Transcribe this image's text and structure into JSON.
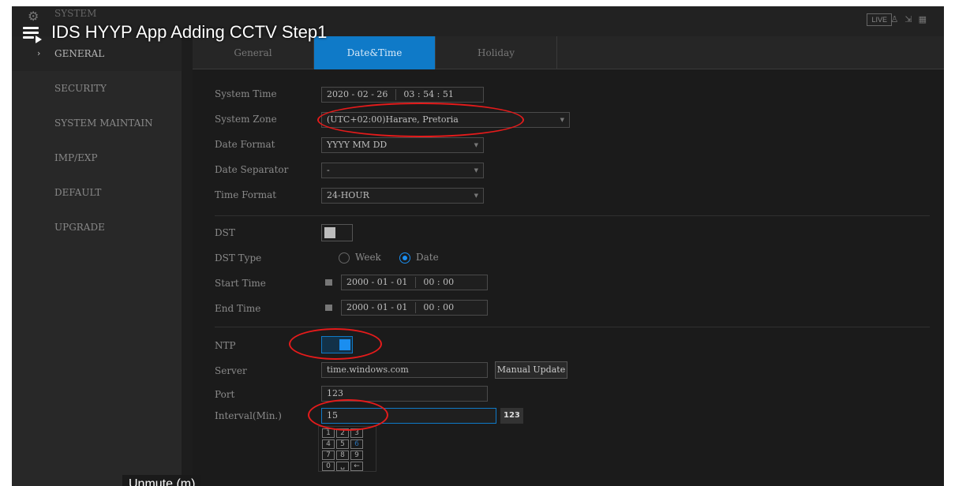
{
  "video": {
    "title": "IDS HYYP App Adding CCTV Step1",
    "tooltip": "Unmute (m)"
  },
  "topbar": {
    "system_label": "SYSTEM",
    "live_label": "LIVE",
    "icons": [
      "user-icon",
      "logout-icon",
      "grid-icon"
    ]
  },
  "sidebar": {
    "items": [
      {
        "label": "GENERAL",
        "active": true
      },
      {
        "label": "SECURITY"
      },
      {
        "label": "SYSTEM MAINTAIN"
      },
      {
        "label": "IMP/EXP"
      },
      {
        "label": "DEFAULT"
      },
      {
        "label": "UPGRADE"
      }
    ]
  },
  "tabs": [
    {
      "label": "General"
    },
    {
      "label": "Date&Time",
      "active": true
    },
    {
      "label": "Holiday"
    }
  ],
  "form": {
    "system_time": {
      "label": "System Time",
      "date": "2020 - 02 - 26",
      "time": "03 : 54 : 51"
    },
    "system_zone": {
      "label": "System Zone",
      "value": "(UTC+02:00)Harare, Pretoria"
    },
    "date_format": {
      "label": "Date Format",
      "value": "YYYY MM DD"
    },
    "date_separator": {
      "label": "Date Separator",
      "value": "-"
    },
    "time_format": {
      "label": "Time Format",
      "value": "24-HOUR"
    },
    "dst": {
      "label": "DST",
      "enabled": false
    },
    "dst_type": {
      "label": "DST Type",
      "options": [
        "Week",
        "Date"
      ],
      "selected": "Date"
    },
    "start_time": {
      "label": "Start Time",
      "date": "2000 - 01 - 01",
      "time": "00 : 00"
    },
    "end_time": {
      "label": "End Time",
      "date": "2000 - 01 - 01",
      "time": "00 : 00"
    },
    "ntp": {
      "label": "NTP",
      "enabled": true
    },
    "server": {
      "label": "Server",
      "value": "time.windows.com",
      "button": "Manual Update"
    },
    "port": {
      "label": "Port",
      "value": "123"
    },
    "interval": {
      "label": "Interval(Min.)",
      "value": "15",
      "keyboard_tag": "123"
    }
  },
  "keypad": {
    "keys": [
      "1",
      "2",
      "3",
      "4",
      "5",
      "6",
      "7",
      "8",
      "9",
      "0",
      "␣",
      "←"
    ]
  },
  "colors": {
    "accent": "#0f7ac8",
    "annotation": "#e41b1b",
    "background": "#1b1b1b"
  }
}
